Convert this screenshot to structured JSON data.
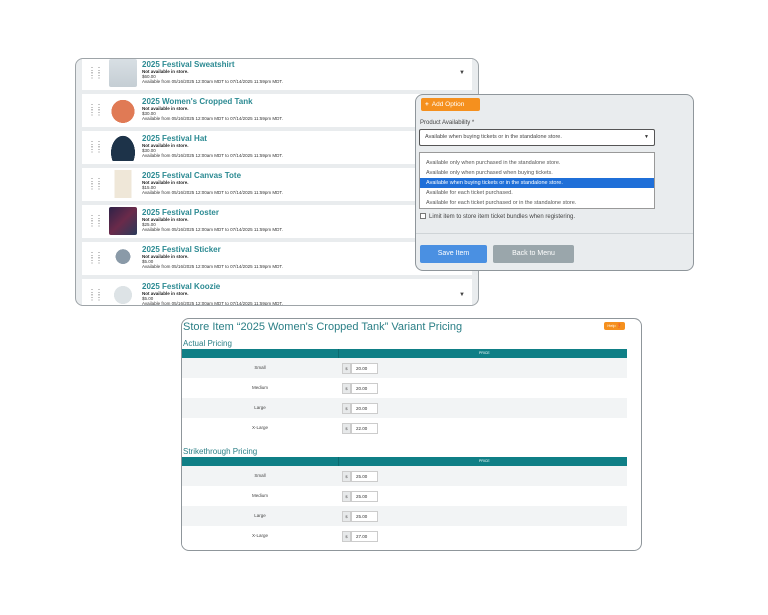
{
  "store_list": {
    "items": [
      {
        "name": "2025 Festival Sweatshirt",
        "status": "Not available in store.",
        "price": "$60.00",
        "availability": "Available from 05/16/2025 12:00am MDT to 07/14/2025 11:59pm MDT.",
        "thumb": "sweatshirt-image"
      },
      {
        "name": "2025 Women's Cropped Tank",
        "status": "Not available in store.",
        "price": "$30.00",
        "availability": "Available from 05/16/2025 12:00am MDT to 07/14/2025 11:59pm MDT.",
        "thumb": "tank-image"
      },
      {
        "name": "2025 Festival Hat",
        "status": "Not available in store.",
        "price": "$30.00",
        "availability": "Available from 05/16/2025 12:00am MDT to 07/14/2025 11:59pm MDT.",
        "thumb": "hat-image"
      },
      {
        "name": "2025 Festival Canvas Tote",
        "status": "Not available in store.",
        "price": "$15.00",
        "availability": "Available from 05/16/2025 12:00am MDT to 07/14/2025 11:59pm MDT.",
        "thumb": "tote-image"
      },
      {
        "name": "2025 Festival Poster",
        "status": "Not available in store.",
        "price": "$25.00",
        "availability": "Available from 05/16/2025 12:00am MDT to 07/14/2025 11:59pm MDT.",
        "thumb": "poster-image"
      },
      {
        "name": "2025 Festival Sticker",
        "status": "Not available in store.",
        "price": "$5.00",
        "availability": "Available from 05/16/2025 12:00am MDT to 07/14/2025 11:59pm MDT.",
        "thumb": "sticker-image"
      },
      {
        "name": "2025 Festival Koozie",
        "status": "Not available in store.",
        "price": "$5.00",
        "availability": "Available from 05/16/2025 12:00am MDT to 07/14/2025 11:59pm MDT.",
        "thumb": "koozie-image"
      }
    ]
  },
  "options_panel": {
    "add_option_label": "Add Option",
    "availability_label": "Product Availability *",
    "availability_selected": "Available when buying tickets or in the standalone store.",
    "availability_options": [
      "Available only when purchased in the standalone store.",
      "Available only when purchased when buying tickets.",
      "Available when buying tickets or in the standalone store.",
      "Available for each ticket purchased.",
      "Available for each ticket purchased or in the standalone store."
    ],
    "selected_index": 2,
    "limit_label": "Limit item to store item ticket bundles when registering.",
    "save_label": "Save Item",
    "back_label": "Back to Menu"
  },
  "pricing": {
    "title": "Store Item “2025 Women's Cropped Tank” Variant Pricing",
    "help_label": "Help",
    "price_header": "PRICE",
    "currency": "$",
    "actual": {
      "title": "Actual Pricing",
      "rows": [
        {
          "size": "Small",
          "value": "20.00"
        },
        {
          "size": "Medium",
          "value": "20.00"
        },
        {
          "size": "Large",
          "value": "20.00"
        },
        {
          "size": "X-Large",
          "value": "22.00"
        }
      ]
    },
    "strikethrough": {
      "title": "Strikethrough Pricing",
      "rows": [
        {
          "size": "Small",
          "value": "25.00"
        },
        {
          "size": "Medium",
          "value": "25.00"
        },
        {
          "size": "Large",
          "value": "25.00"
        },
        {
          "size": "X-Large",
          "value": "27.00"
        }
      ]
    }
  },
  "colors": {
    "accent_teal": "#2b8a92",
    "header_teal": "#0f7f86",
    "orange": "#f5901e",
    "save_blue": "#4a90e2",
    "selected_blue": "#1f6fd8"
  }
}
